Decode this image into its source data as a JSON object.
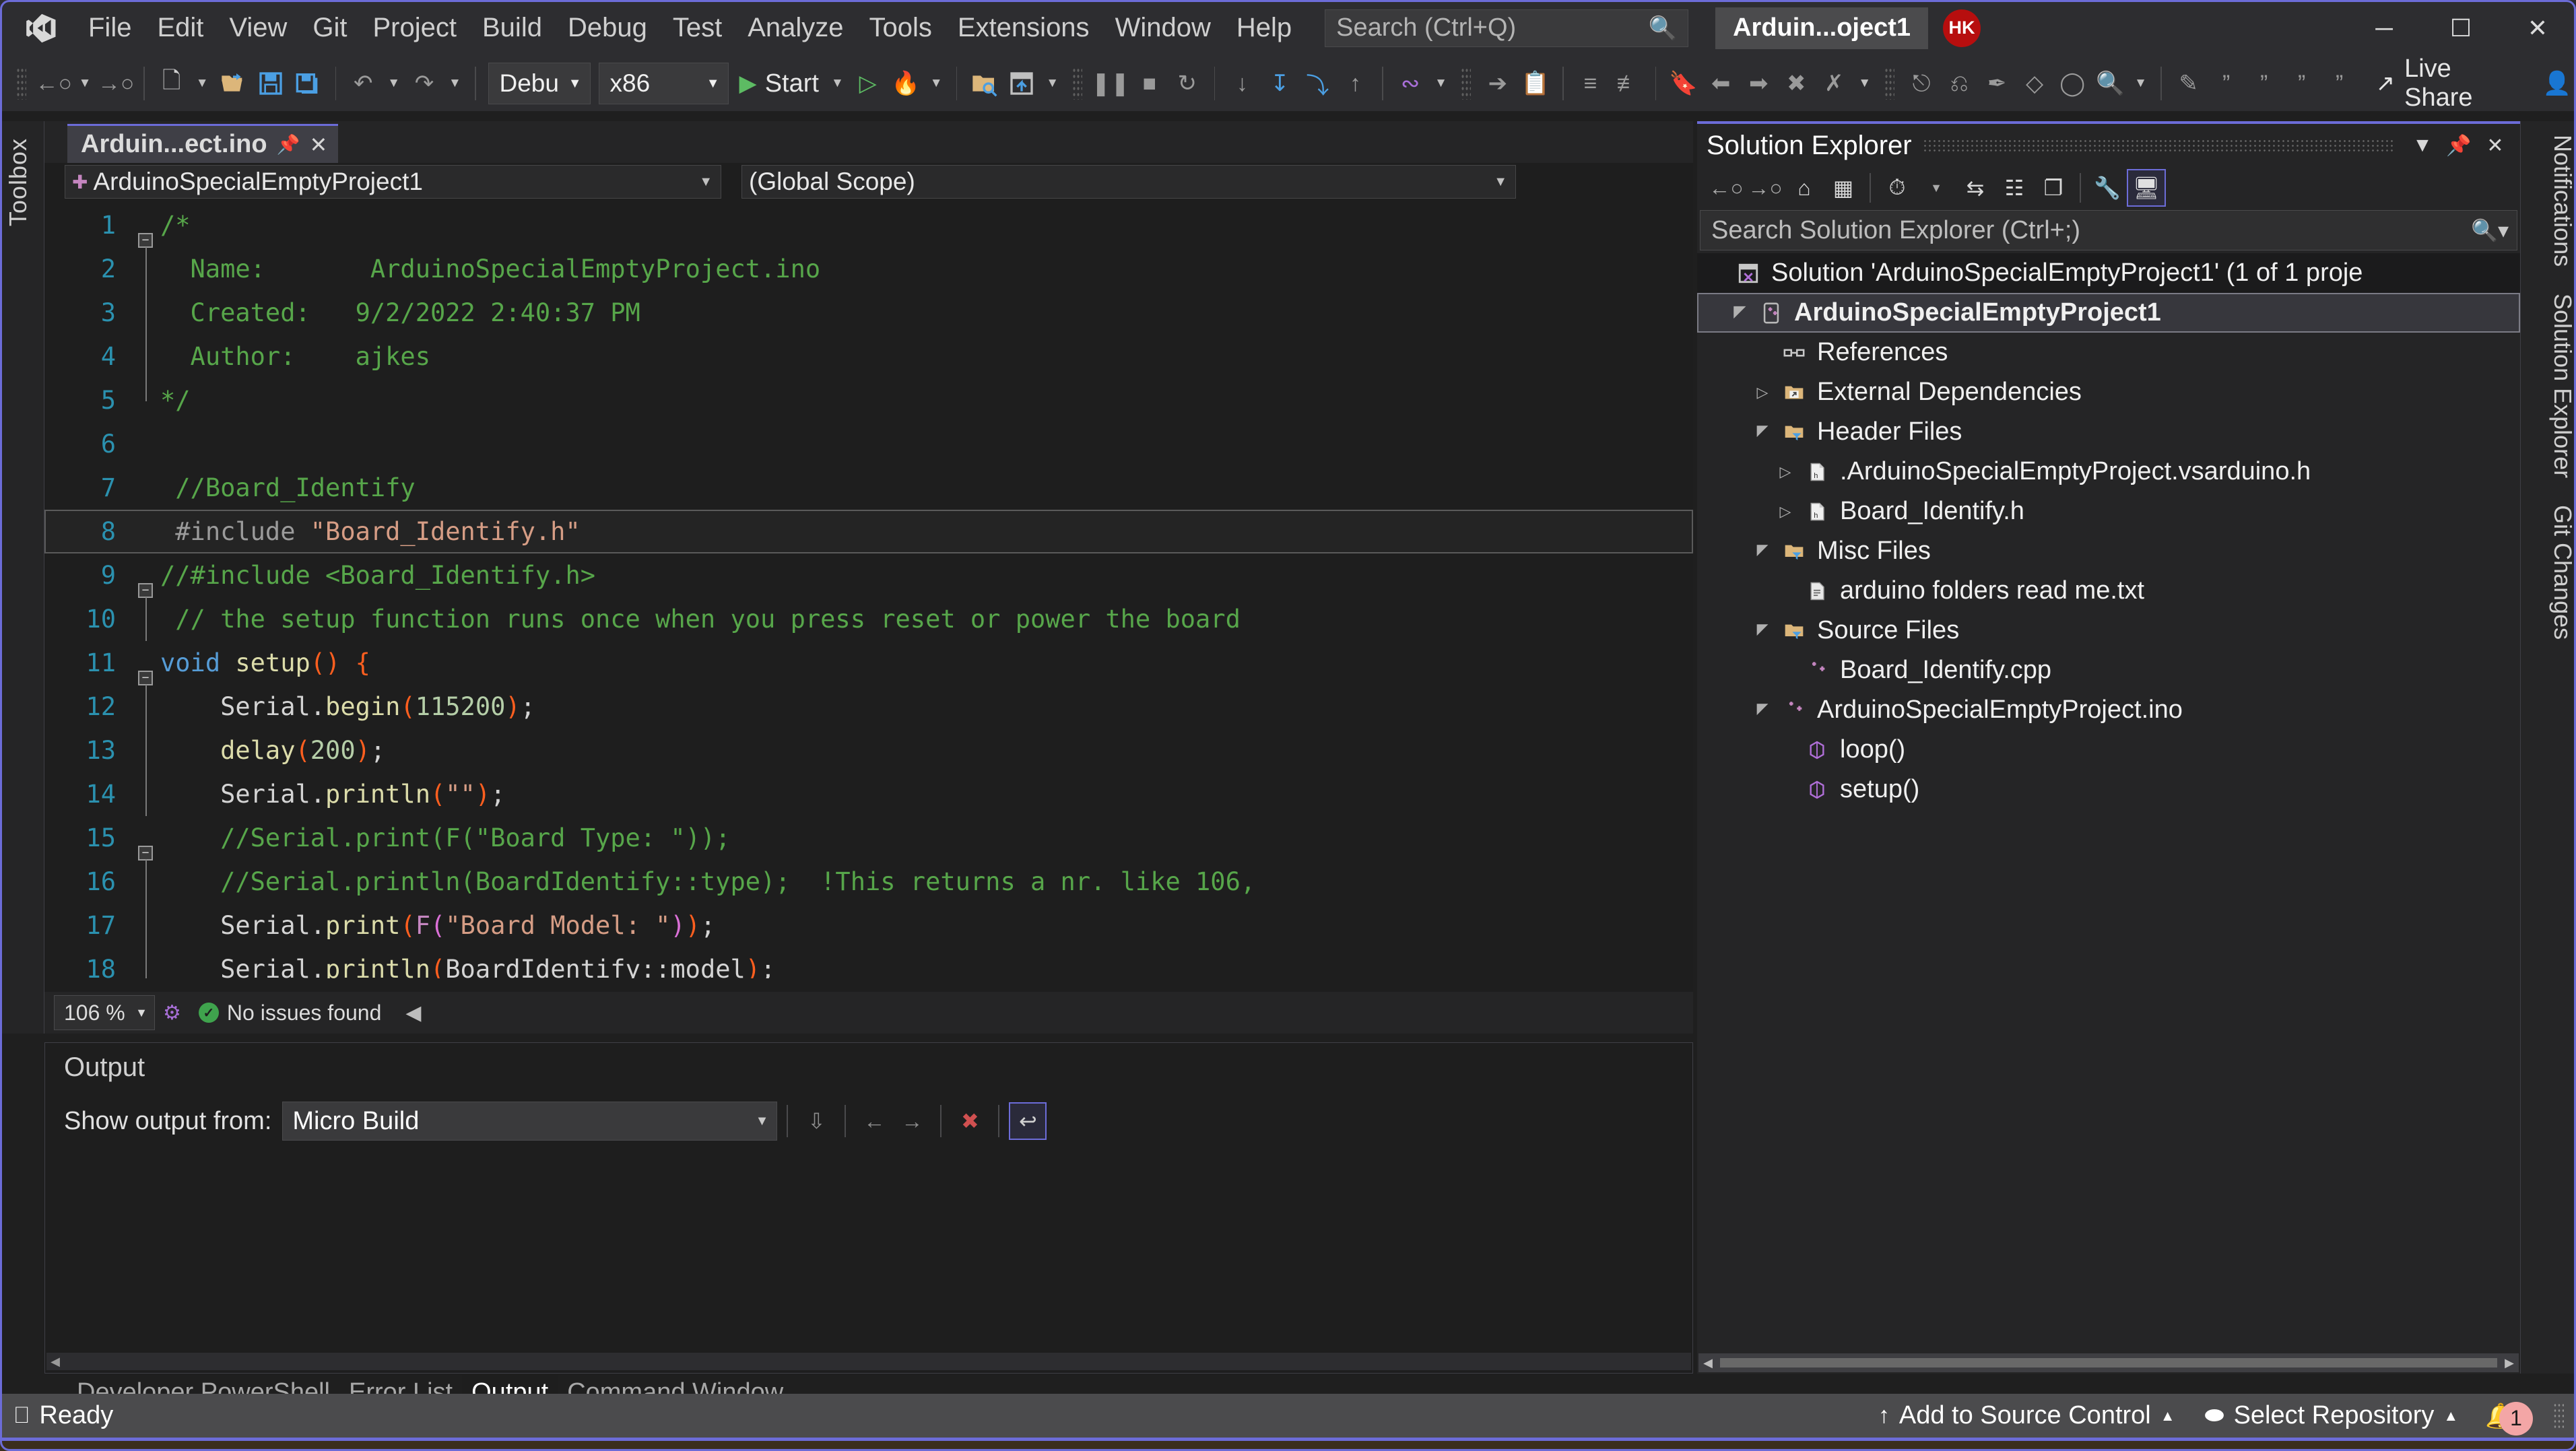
{
  "app": {
    "title_chip": "Arduin...oject1",
    "avatar_initials": "HK",
    "logo_icon": "visual-studio-logo"
  },
  "menu": {
    "items": [
      "File",
      "Edit",
      "View",
      "Git",
      "Project",
      "Build",
      "Debug",
      "Test",
      "Analyze",
      "Tools",
      "Extensions",
      "Window",
      "Help"
    ]
  },
  "title_search": {
    "placeholder": "Search (Ctrl+Q)",
    "icon": "magnifier-icon"
  },
  "window_controls": {
    "minimize": "─",
    "maximize": "☐",
    "close": "✕"
  },
  "toolbar": {
    "config_combo": "Debu",
    "platform_combo": "x86",
    "start_label": "Start",
    "live_share_label": "Live Share"
  },
  "toolbox": {
    "label": "Toolbox"
  },
  "editor": {
    "tab_label": "Arduin...ect.ino",
    "nav_left": "ArduinoSpecialEmptyProject1",
    "nav_right": "(Global Scope)",
    "zoom": "106 %",
    "issues": "No issues found",
    "current_line": 8,
    "lines": [
      {
        "n": 1,
        "fold": "minus",
        "tokens": [
          {
            "t": "/*",
            "c": "c-com"
          }
        ]
      },
      {
        "n": 2,
        "indent": true,
        "tokens": [
          {
            "t": "  Name:       ArduinoSpecialEmptyProject.ino",
            "c": "c-com"
          }
        ]
      },
      {
        "n": 3,
        "indent": true,
        "tokens": [
          {
            "t": "  Created:   9/2/2022 2:40:37 PM",
            "c": "c-com"
          }
        ]
      },
      {
        "n": 4,
        "indent": true,
        "tokens": [
          {
            "t": "  Author:    ajkes",
            "c": "c-com"
          }
        ]
      },
      {
        "n": 5,
        "endline": true,
        "tokens": [
          {
            "t": "*/",
            "c": "c-com"
          }
        ]
      },
      {
        "n": 6,
        "tokens": []
      },
      {
        "n": 7,
        "tokens": [
          {
            "t": " //Board_Identify",
            "c": "c-com"
          }
        ]
      },
      {
        "n": 8,
        "current": true,
        "tokens": [
          {
            "t": " #include ",
            "c": "c-mac"
          },
          {
            "t": "\"Board_Identify.h\"",
            "c": "c-str"
          }
        ]
      },
      {
        "n": 9,
        "fold": "minus",
        "tokens": [
          {
            "t": "//#include <Board_Identify.h>",
            "c": "c-com"
          }
        ]
      },
      {
        "n": 10,
        "indent": true,
        "tokens": [
          {
            "t": " // the setup function runs once when you press reset or power the board",
            "c": "c-com"
          }
        ]
      },
      {
        "n": 11,
        "fold": "minus",
        "tokens": [
          {
            "t": "void",
            "c": "c-key"
          },
          {
            "t": " ",
            "c": "c-id"
          },
          {
            "t": "setup",
            "c": "c-fn"
          },
          {
            "t": "()",
            "c": "c-par"
          },
          {
            "t": " ",
            "c": "c-id"
          },
          {
            "t": "{",
            "c": "c-par"
          }
        ]
      },
      {
        "n": 12,
        "indent": true,
        "tokens": [
          {
            "t": "    Serial",
            "c": "c-id"
          },
          {
            "t": ".",
            "c": "c-id"
          },
          {
            "t": "begin",
            "c": "c-fn"
          },
          {
            "t": "(",
            "c": "c-par"
          },
          {
            "t": "115200",
            "c": "c-num"
          },
          {
            "t": ")",
            "c": "c-par"
          },
          {
            "t": ";",
            "c": "c-id"
          }
        ]
      },
      {
        "n": 13,
        "indent": true,
        "tokens": [
          {
            "t": "    delay",
            "c": "c-fn"
          },
          {
            "t": "(",
            "c": "c-par"
          },
          {
            "t": "200",
            "c": "c-num"
          },
          {
            "t": ")",
            "c": "c-par"
          },
          {
            "t": ";",
            "c": "c-id"
          }
        ]
      },
      {
        "n": 14,
        "indent": true,
        "tokens": [
          {
            "t": "    Serial",
            "c": "c-id"
          },
          {
            "t": ".",
            "c": "c-id"
          },
          {
            "t": "println",
            "c": "c-fn"
          },
          {
            "t": "(",
            "c": "c-par"
          },
          {
            "t": "\"\"",
            "c": "c-str"
          },
          {
            "t": ")",
            "c": "c-par"
          },
          {
            "t": ";",
            "c": "c-id"
          }
        ]
      },
      {
        "n": 15,
        "fold": "minus",
        "indent": true,
        "tokens": [
          {
            "t": "    //Serial.print(F(\"Board Type: \"));",
            "c": "c-com"
          }
        ]
      },
      {
        "n": 16,
        "indent": true,
        "tokens": [
          {
            "t": "    //Serial.println(BoardIdentify::type);  !This returns a nr. like 106,",
            "c": "c-com"
          }
        ]
      },
      {
        "n": 17,
        "indent": true,
        "tokens": [
          {
            "t": "    Serial",
            "c": "c-id"
          },
          {
            "t": ".",
            "c": "c-id"
          },
          {
            "t": "print",
            "c": "c-fn"
          },
          {
            "t": "(",
            "c": "c-par"
          },
          {
            "t": "F",
            "c": "c-macro-arg"
          },
          {
            "t": "(",
            "c": "c-par2"
          },
          {
            "t": "\"Board Model: \"",
            "c": "c-str"
          },
          {
            "t": ")",
            "c": "c-par2"
          },
          {
            "t": ")",
            "c": "c-par"
          },
          {
            "t": ";",
            "c": "c-id"
          }
        ]
      },
      {
        "n": 18,
        "indent": true,
        "tokens": [
          {
            "t": "    Serial",
            "c": "c-id"
          },
          {
            "t": ".",
            "c": "c-id"
          },
          {
            "t": "println",
            "c": "c-fn"
          },
          {
            "t": "(",
            "c": "c-par"
          },
          {
            "t": "BoardIdentify::model",
            "c": "c-id"
          },
          {
            "t": ")",
            "c": "c-par"
          },
          {
            "t": ";",
            "c": "c-id"
          }
        ]
      }
    ]
  },
  "output": {
    "title": "Output",
    "show_from_label": "Show output from:",
    "selected_source": "Micro Build",
    "body_text": ""
  },
  "bottom_tabs": {
    "items": [
      "Developer PowerShell",
      "Error List",
      "Output",
      "Command Window"
    ],
    "active": "Output"
  },
  "solution_explorer": {
    "title": "Solution Explorer",
    "search_placeholder": "Search Solution Explorer (Ctrl+;)",
    "tree": [
      {
        "label": "Solution 'ArduinoSpecialEmptyProject1' (1 of 1 proje",
        "indent": 0,
        "expander": "",
        "icon": "solution-icon",
        "kind": "solution"
      },
      {
        "label": "ArduinoSpecialEmptyProject1",
        "indent": 1,
        "expander": "▲",
        "icon": "arduino-project-icon",
        "kind": "project",
        "selected": true
      },
      {
        "label": "References",
        "indent": 2,
        "expander": "",
        "icon": "references-icon"
      },
      {
        "label": "External Dependencies",
        "indent": 2,
        "expander": "▶",
        "icon": "ext-folder-icon"
      },
      {
        "label": "Header Files",
        "indent": 2,
        "expander": "▲",
        "icon": "filter-folder-icon"
      },
      {
        "label": ".ArduinoSpecialEmptyProject.vsarduino.h",
        "indent": 3,
        "expander": "▶",
        "icon": "header-file-icon"
      },
      {
        "label": "Board_Identify.h",
        "indent": 3,
        "expander": "▶",
        "icon": "header-file-icon"
      },
      {
        "label": "Misc Files",
        "indent": 2,
        "expander": "▲",
        "icon": "filter-folder-icon"
      },
      {
        "label": "arduino folders read me.txt",
        "indent": 3,
        "expander": "",
        "icon": "text-file-icon"
      },
      {
        "label": "Source Files",
        "indent": 2,
        "expander": "▲",
        "icon": "filter-folder-icon"
      },
      {
        "label": "Board_Identify.cpp",
        "indent": 3,
        "expander": "",
        "icon": "cpp-file-icon"
      },
      {
        "label": "ArduinoSpecialEmptyProject.ino",
        "indent": 2,
        "expander": "▲",
        "icon": "cpp-file-icon"
      },
      {
        "label": "loop()",
        "indent": 3,
        "expander": "",
        "icon": "method-icon"
      },
      {
        "label": "setup()",
        "indent": 3,
        "expander": "",
        "icon": "method-icon"
      }
    ]
  },
  "right_tabs": [
    "Notifications",
    "Solution Explorer",
    "Git Changes"
  ],
  "statusbar": {
    "ready": "Ready",
    "add_to_source_control": "Add to Source Control",
    "select_repository": "Select Repository",
    "notification_count": "1"
  },
  "colors": {
    "accent": "#6c6cd8",
    "titlebar": "#2d2d30",
    "editor_bg": "#1e1e1e",
    "panel_bg": "#252526",
    "status_bg": "#4b4b4d",
    "comment": "#57a64a",
    "keyword": "#569cd6",
    "string": "#d69d85",
    "number": "#b5cea8",
    "function": "#dcdcaa",
    "linenumber": "#2b91af",
    "bracket": "#ff5f1f",
    "avatar_bg": "#b70e0e"
  }
}
